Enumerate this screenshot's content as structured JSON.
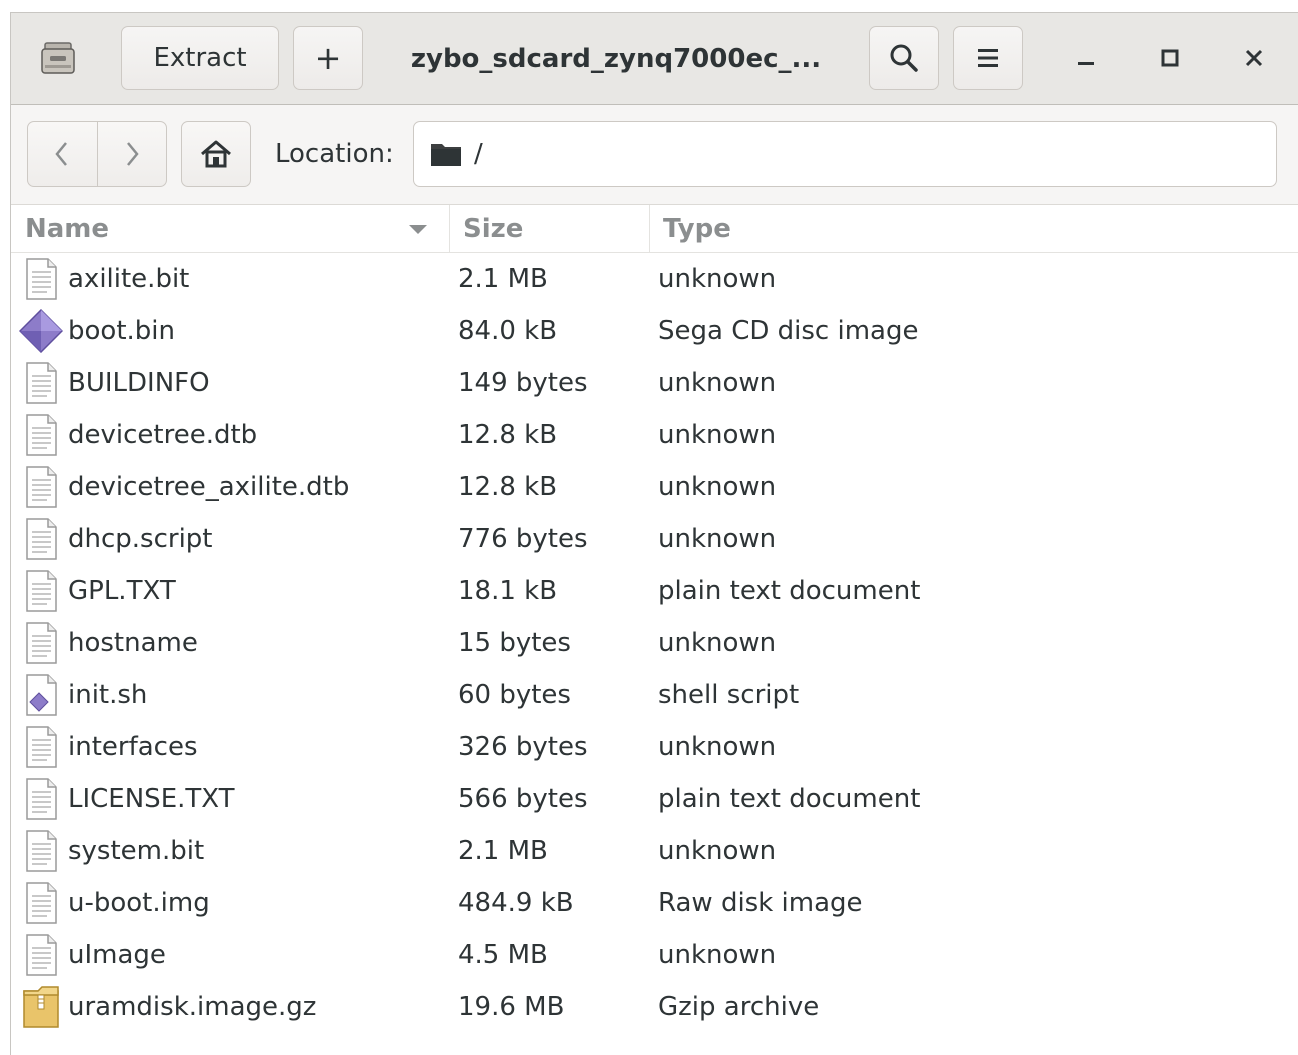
{
  "headerbar": {
    "app_icon": "archive-manager-icon",
    "extract_label": "Extract",
    "add_label": "+",
    "title": "zybo_sdcard_zynq7000ec_...",
    "search_icon": "search-icon",
    "menu_icon": "hamburger-menu-icon",
    "minimize_icon": "minimize-icon",
    "maximize_icon": "maximize-icon",
    "close_icon": "close-icon"
  },
  "locationbar": {
    "back_icon": "chevron-left-icon",
    "forward_icon": "chevron-right-icon",
    "home_icon": "home-icon",
    "label": "Location:",
    "path": "/"
  },
  "columns": {
    "name": "Name",
    "size": "Size",
    "type": "Type"
  },
  "files": [
    {
      "name": "axilite.bit",
      "size": "2.1 MB",
      "type": "unknown",
      "icon": "text-file-icon"
    },
    {
      "name": "boot.bin",
      "size": "84.0 kB",
      "type": "Sega CD disc image",
      "icon": "disc-image-icon"
    },
    {
      "name": "BUILDINFO",
      "size": "149 bytes",
      "type": "unknown",
      "icon": "text-file-icon"
    },
    {
      "name": "devicetree.dtb",
      "size": "12.8 kB",
      "type": "unknown",
      "icon": "text-file-icon"
    },
    {
      "name": "devicetree_axilite.dtb",
      "size": "12.8 kB",
      "type": "unknown",
      "icon": "text-file-icon"
    },
    {
      "name": "dhcp.script",
      "size": "776 bytes",
      "type": "unknown",
      "icon": "text-file-icon"
    },
    {
      "name": "GPL.TXT",
      "size": "18.1 kB",
      "type": "plain text document",
      "icon": "text-file-icon"
    },
    {
      "name": "hostname",
      "size": "15 bytes",
      "type": "unknown",
      "icon": "text-file-icon"
    },
    {
      "name": "init.sh",
      "size": "60 bytes",
      "type": "shell script",
      "icon": "script-file-icon"
    },
    {
      "name": "interfaces",
      "size": "326 bytes",
      "type": "unknown",
      "icon": "text-file-icon"
    },
    {
      "name": "LICENSE.TXT",
      "size": "566 bytes",
      "type": "plain text document",
      "icon": "text-file-icon"
    },
    {
      "name": "system.bit",
      "size": "2.1 MB",
      "type": "unknown",
      "icon": "text-file-icon"
    },
    {
      "name": "u-boot.img",
      "size": "484.9 kB",
      "type": "Raw disk image",
      "icon": "text-file-icon"
    },
    {
      "name": "uImage",
      "size": "4.5 MB",
      "type": "unknown",
      "icon": "text-file-icon"
    },
    {
      "name": "uramdisk.image.gz",
      "size": "19.6 MB",
      "type": "Gzip archive",
      "icon": "archive-file-icon"
    }
  ],
  "colors": {
    "headerbar_bg": "#e8e7e4",
    "toolbar_bg": "#f6f5f4",
    "text": "#2e3436",
    "header_text": "#8b8e8f",
    "disc_purple": "#8d7cc9",
    "archive_yellow": "#e9c46a"
  }
}
